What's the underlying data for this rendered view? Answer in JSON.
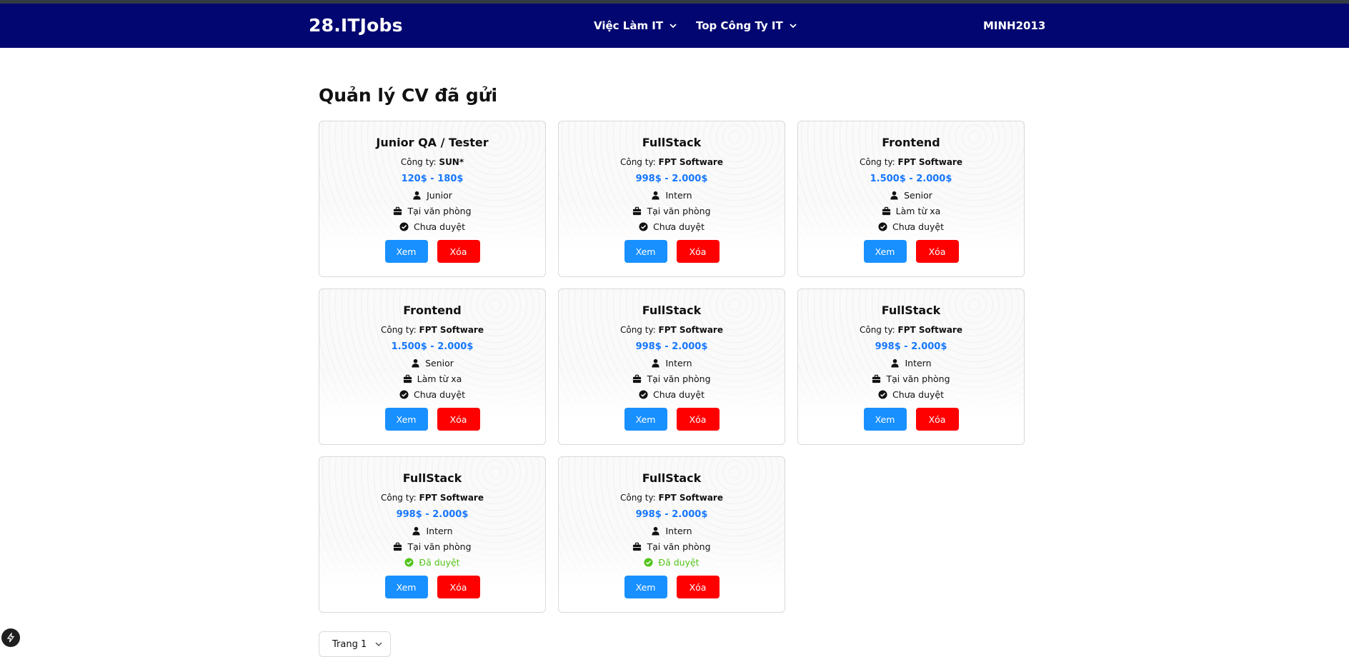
{
  "header": {
    "logo": "28.ITJobs",
    "nav": [
      {
        "label": "Việc Làm IT"
      },
      {
        "label": "Top Công Ty IT"
      }
    ],
    "user": "MINH2013"
  },
  "page": {
    "title": "Quản lý CV đã gửi"
  },
  "card_labels": {
    "company_prefix": "Công ty: ",
    "view_button": "Xem",
    "delete_button": "Xóa"
  },
  "cards": [
    {
      "title": "Junior QA / Tester",
      "company": "SUN*",
      "salary": "120$ - 180$",
      "level": "Junior",
      "work_mode": "Tại văn phòng",
      "status": "Chưa duyệt",
      "approved": false
    },
    {
      "title": "FullStack",
      "company": "FPT Software",
      "salary": "998$ - 2.000$",
      "level": "Intern",
      "work_mode": "Tại văn phòng",
      "status": "Chưa duyệt",
      "approved": false
    },
    {
      "title": "Frontend",
      "company": "FPT Software",
      "salary": "1.500$ - 2.000$",
      "level": "Senior",
      "work_mode": "Làm từ xa",
      "status": "Chưa duyệt",
      "approved": false
    },
    {
      "title": "Frontend",
      "company": "FPT Software",
      "salary": "1.500$ - 2.000$",
      "level": "Senior",
      "work_mode": "Làm từ xa",
      "status": "Chưa duyệt",
      "approved": false
    },
    {
      "title": "FullStack",
      "company": "FPT Software",
      "salary": "998$ - 2.000$",
      "level": "Intern",
      "work_mode": "Tại văn phòng",
      "status": "Chưa duyệt",
      "approved": false
    },
    {
      "title": "FullStack",
      "company": "FPT Software",
      "salary": "998$ - 2.000$",
      "level": "Intern",
      "work_mode": "Tại văn phòng",
      "status": "Chưa duyệt",
      "approved": false
    },
    {
      "title": "FullStack",
      "company": "FPT Software",
      "salary": "998$ - 2.000$",
      "level": "Intern",
      "work_mode": "Tại văn phòng",
      "status": "Đã duyệt",
      "approved": true
    },
    {
      "title": "FullStack",
      "company": "FPT Software",
      "salary": "998$ - 2.000$",
      "level": "Intern",
      "work_mode": "Tại văn phòng",
      "status": "Đã duyệt",
      "approved": true
    }
  ],
  "pagination": {
    "selected": "Trang 1"
  },
  "colors": {
    "header_bg": "#020670",
    "salary": "#1677ff",
    "view_button": "#1890ff",
    "delete_button": "#ff0000",
    "approved": "#52c41a"
  },
  "icons": {
    "level": "user-icon",
    "work_mode": "briefcase-icon",
    "status": "check-circle-icon",
    "nav_dropdown": "chevron-down-icon",
    "pager_dropdown": "chevron-down-icon",
    "floating": "lightning-icon"
  }
}
